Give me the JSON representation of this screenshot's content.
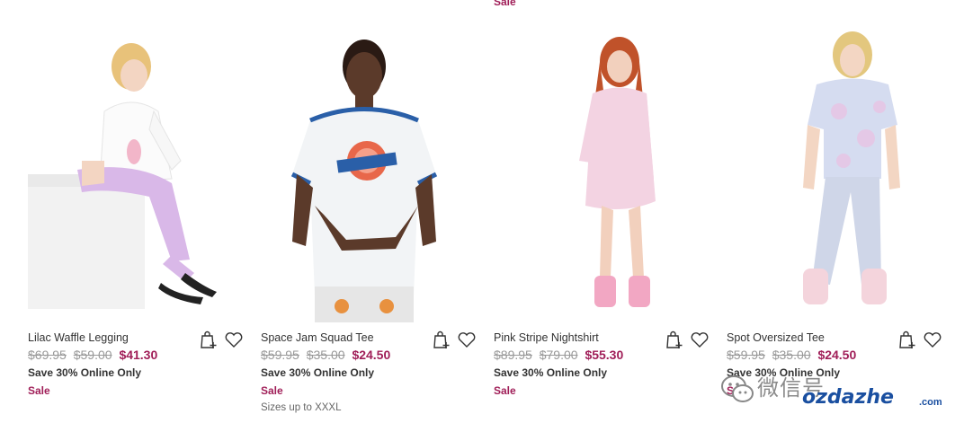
{
  "top_sale_label": "Sale",
  "products": [
    {
      "title": "Lilac Waffle Legging",
      "was_prices": [
        "$69.95",
        "$59.00"
      ],
      "now_price": "$41.30",
      "promo": "Save 30% Online Only",
      "sale": "Sale",
      "sizes": ""
    },
    {
      "title": "Space Jam Squad Tee",
      "was_prices": [
        "$59.95",
        "$35.00"
      ],
      "now_price": "$24.50",
      "promo": "Save 30% Online Only",
      "sale": "Sale",
      "sizes": "Sizes up to XXXL"
    },
    {
      "title": "Pink Stripe Nightshirt",
      "was_prices": [
        "$89.95",
        "$79.00"
      ],
      "now_price": "$55.30",
      "promo": "Save 30% Online Only",
      "sale": "Sale",
      "sizes": ""
    },
    {
      "title": "Spot Oversized Tee",
      "was_prices": [
        "$59.95",
        "$35.00"
      ],
      "now_price": "$24.50",
      "promo": "Save 30% Online Only",
      "sale": "Sale",
      "sizes": ""
    }
  ],
  "icons": {
    "add_to_bag": "shopping-bag-plus-icon",
    "wishlist": "heart-icon"
  },
  "watermark": {
    "cn": "微信号",
    "logo": "ozdazhe",
    "com": ".com"
  },
  "colors": {
    "accent": "#a01e58",
    "strike": "#999999"
  }
}
